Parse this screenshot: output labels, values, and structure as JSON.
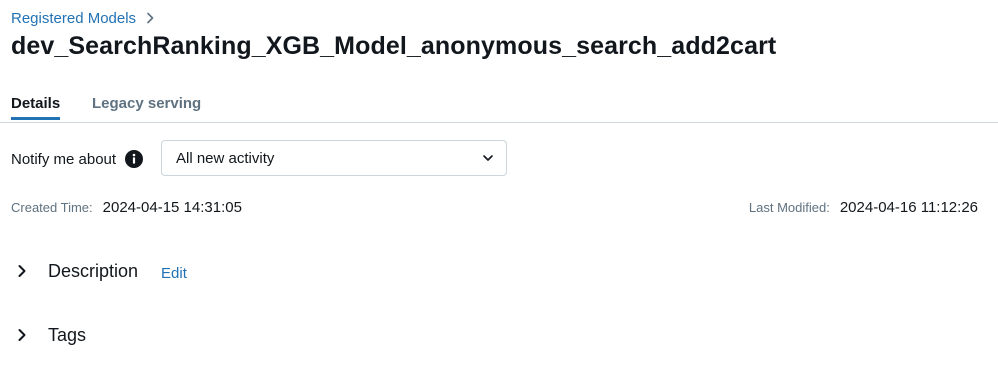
{
  "breadcrumb": {
    "items": [
      {
        "label": "Registered Models"
      }
    ]
  },
  "page": {
    "title": "dev_SearchRanking_XGB_Model_anonymous_search_add2cart"
  },
  "tabs": [
    {
      "label": "Details",
      "active": true
    },
    {
      "label": "Legacy serving",
      "active": false
    }
  ],
  "notify": {
    "label": "Notify me about",
    "selected": "All new activity"
  },
  "meta": {
    "created_label": "Created Time:",
    "created_value": "2024-04-15 14:31:05",
    "modified_label": "Last Modified:",
    "modified_value": "2024-04-16 11:12:26"
  },
  "sections": {
    "description": {
      "title": "Description",
      "edit_label": "Edit"
    },
    "tags": {
      "title": "Tags"
    }
  },
  "colors": {
    "link": "#2272b4",
    "text": "#11171c",
    "muted": "#5f7281",
    "border": "#d1d9e1"
  },
  "icons": {
    "breadcrumb_separator": "chevron-right-icon",
    "info": "info-icon",
    "select_caret": "chevron-down-icon",
    "section_toggle": "chevron-right-icon"
  }
}
